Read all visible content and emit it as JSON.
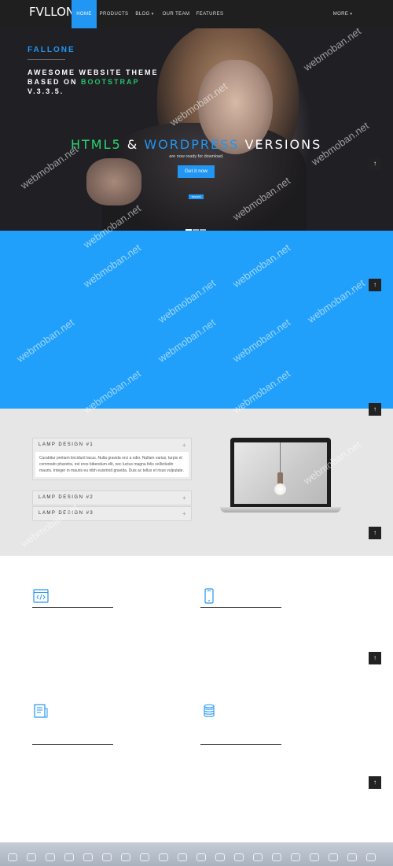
{
  "nav": {
    "logo": "FVLLON3",
    "items": [
      {
        "label": "HOME",
        "active": true
      },
      {
        "label": "PRODUCTS",
        "active": false
      },
      {
        "label": "BLOG",
        "active": false
      },
      {
        "label": "OUR TEAM",
        "active": false
      },
      {
        "label": "FEATURES",
        "active": false
      },
      {
        "label": "MORE",
        "active": false
      }
    ]
  },
  "hero": {
    "brand": "FALLONE",
    "tagline_1": "AWESOME WEBSITE THEME",
    "tagline_2_prefix": "BASED ON ",
    "tagline_2_highlight": "BOOTSTRAP",
    "tagline_3": "V.3.3.5.",
    "headline_green": "HTML5",
    "headline_and": " & ",
    "headline_blue": "WORDPRESS",
    "headline_rest": " VERSIONS",
    "subtext": "are now ready for download.",
    "cta": "Get it now",
    "badge": "TRENDS",
    "slides": 3,
    "active_slide": 1
  },
  "accordion": [
    {
      "title": "LAMP DESIGN #1",
      "open": true,
      "body": "Curabitur pretium tincidunt lacus. Nulla gravida orci a odio. Nullam varius, turpis et commodo pharetra, est eros bibendum elit, nec luctus magna felis sollicitudin mauris. Integer in mauris eu nibh euismod gravida. Duis ac tellus et risus vulputate."
    },
    {
      "title": "LAMP DESIGN #2",
      "open": false
    },
    {
      "title": "LAMP DESIGN #3",
      "open": false
    }
  ],
  "features": [
    {
      "icon": "code-window-icon"
    },
    {
      "icon": "mobile-phone-icon"
    },
    {
      "icon": "document-icon"
    },
    {
      "icon": "coin-stack-icon"
    }
  ],
  "back_to_top": "↑",
  "watermark": "webmoban.net",
  "colors": {
    "accent": "#2196f3",
    "blue_section": "#21a0fb",
    "green": "#2bd66f",
    "navbar": "#1f1f1f",
    "grey_section": "#e6e6e6"
  }
}
